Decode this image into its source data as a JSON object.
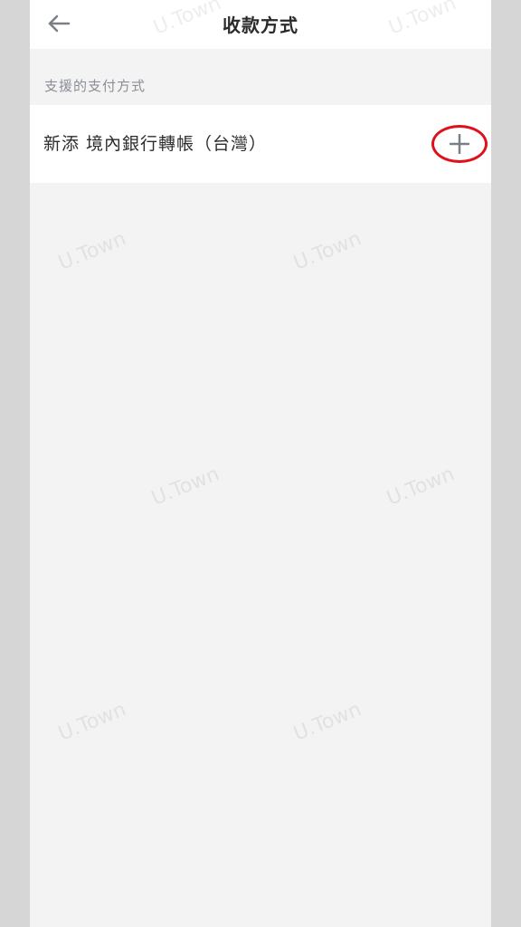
{
  "header": {
    "title": "收款方式",
    "back_icon": "arrow-left-icon"
  },
  "section": {
    "label": "支援的支付方式"
  },
  "methods": [
    {
      "label": "新添 境內銀行轉帳（台灣）",
      "action_icon": "plus-icon"
    }
  ],
  "watermark": {
    "text": "U.Town"
  },
  "colors": {
    "background": "#f3f3f3",
    "surface": "#ffffff",
    "highlight": "#e0101a",
    "secondary_text": "#8a8f96"
  }
}
